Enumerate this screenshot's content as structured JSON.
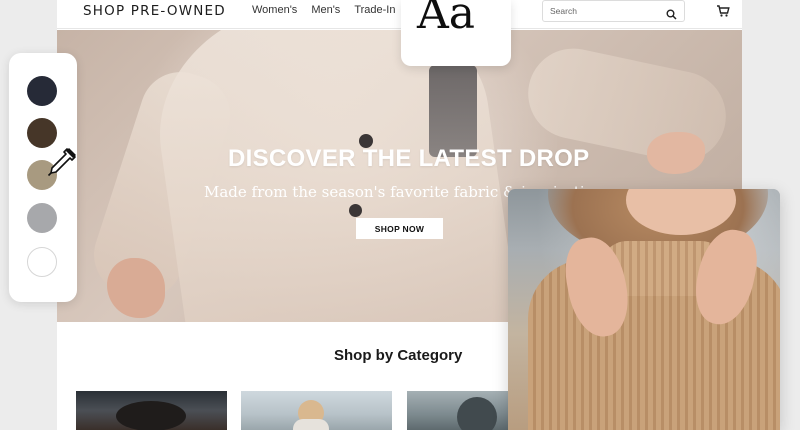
{
  "brand": "SHOP PRE-OWNED",
  "nav": {
    "items": [
      "Women's",
      "Men's",
      "Trade-In"
    ]
  },
  "search": {
    "placeholder": "Search",
    "icon": "search-icon"
  },
  "cart": {
    "icon": "cart-icon"
  },
  "hero": {
    "title": "DISCOVER THE LATEST DROP",
    "subtitle": "Made from the season's favorite fabric & inspiration",
    "cta": "SHOP NOW"
  },
  "section": {
    "title": "Shop by Category"
  },
  "font_card": {
    "sample": "Aa"
  },
  "palette": {
    "colors": [
      "#262a37",
      "#463628",
      "#a89a80",
      "#a7a8ab",
      "#ffffff"
    ],
    "tool_icon": "eyedropper-icon"
  }
}
